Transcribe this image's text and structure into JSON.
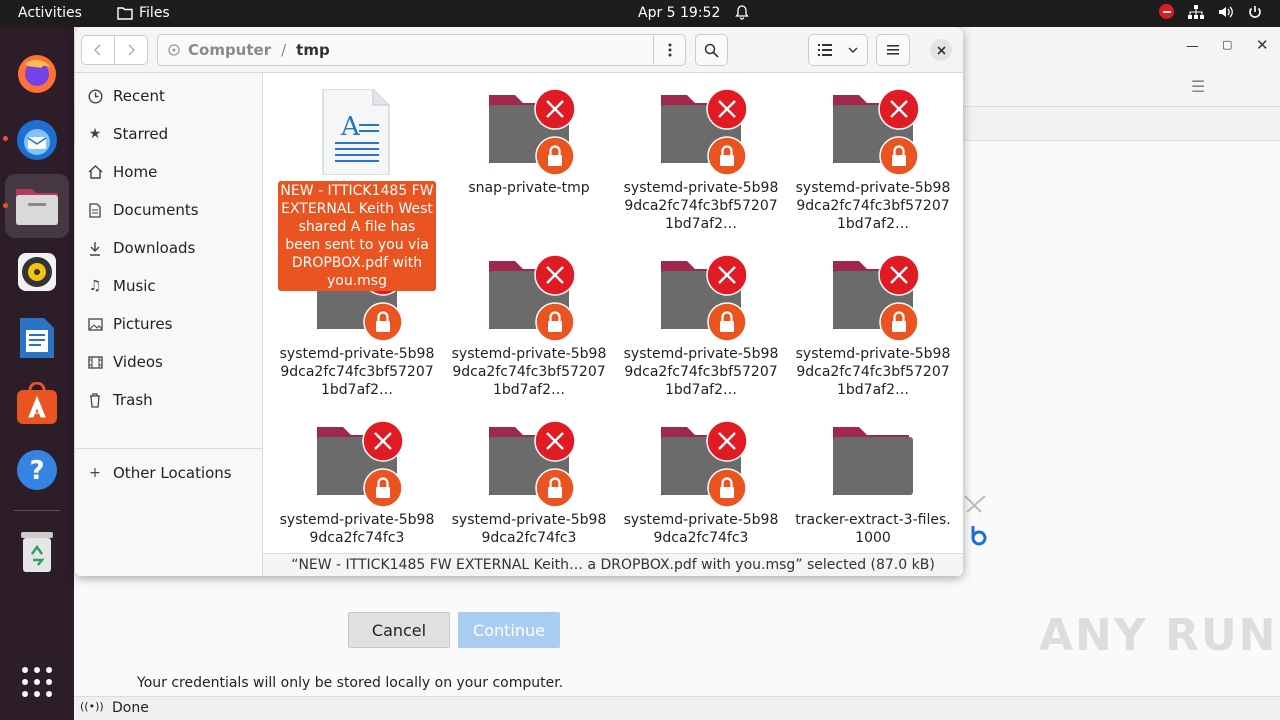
{
  "topbar": {
    "activities": "Activities",
    "app_name": "Files",
    "clock": "Apr 5  19:52"
  },
  "dock": {
    "items": [
      "firefox-icon",
      "thunderbird-icon",
      "files-icon",
      "rhythmbox-icon",
      "writer-icon",
      "app-center-icon",
      "help-icon",
      "trash-icon",
      "show-apps-icon"
    ]
  },
  "background_window": {
    "cancel_label": "Cancel",
    "continue_label": "Continue",
    "credentials_note": "Your credentials will only be stored locally on your computer.",
    "status": "Done",
    "watermark": "ANY RUN"
  },
  "dialog": {
    "path": {
      "root": "Computer",
      "separator": "/",
      "current": "tmp"
    },
    "sidebar": [
      {
        "label": "Recent",
        "icon": "clock-icon"
      },
      {
        "label": "Starred",
        "icon": "star-icon"
      },
      {
        "label": "Home",
        "icon": "home-icon"
      },
      {
        "label": "Documents",
        "icon": "document-icon"
      },
      {
        "label": "Downloads",
        "icon": "download-icon"
      },
      {
        "label": "Music",
        "icon": "music-icon"
      },
      {
        "label": "Pictures",
        "icon": "picture-icon"
      },
      {
        "label": "Videos",
        "icon": "video-icon"
      },
      {
        "label": "Trash",
        "icon": "trash-icon"
      }
    ],
    "other_locations": "Other Locations",
    "files": [
      {
        "name": "NEW - ITTICK1485 FW EXTERNAL Keith West shared A file has been sent to you via DROPBOX.pdf with you.msg",
        "type": "document",
        "selected": true
      },
      {
        "name": "snap-private-tmp",
        "type": "locked-folder"
      },
      {
        "name": "systemd-private-5b989dca2fc74fc3bf572071bd7af2…",
        "type": "locked-folder"
      },
      {
        "name": "systemd-private-5b989dca2fc74fc3bf572071bd7af2…",
        "type": "locked-folder"
      },
      {
        "name": "systemd-private-5b989dca2fc74fc3bf572071bd7af2…",
        "type": "locked-folder"
      },
      {
        "name": "systemd-private-5b989dca2fc74fc3bf572071bd7af2…",
        "type": "locked-folder"
      },
      {
        "name": "systemd-private-5b989dca2fc74fc3bf572071bd7af2…",
        "type": "locked-folder"
      },
      {
        "name": "systemd-private-5b989dca2fc74fc3bf572071bd7af2…",
        "type": "locked-folder"
      },
      {
        "name": "systemd-private-5b989dca2fc74fc3",
        "type": "locked-folder"
      },
      {
        "name": "systemd-private-5b989dca2fc74fc3",
        "type": "locked-folder"
      },
      {
        "name": "systemd-private-5b989dca2fc74fc3",
        "type": "locked-folder"
      },
      {
        "name": "tracker-extract-3-files.1000",
        "type": "folder"
      }
    ],
    "status": "“NEW - ITTICK1485 FW EXTERNAL Keith… a DROPBOX.pdf with you.msg” selected (87.0 kB)"
  },
  "colors": {
    "accent": "#e95420",
    "folder": "#6b6b6b",
    "folder_tab": "#a0284a",
    "error_badge": "#e01b24",
    "lock_badge": "#e95420"
  }
}
